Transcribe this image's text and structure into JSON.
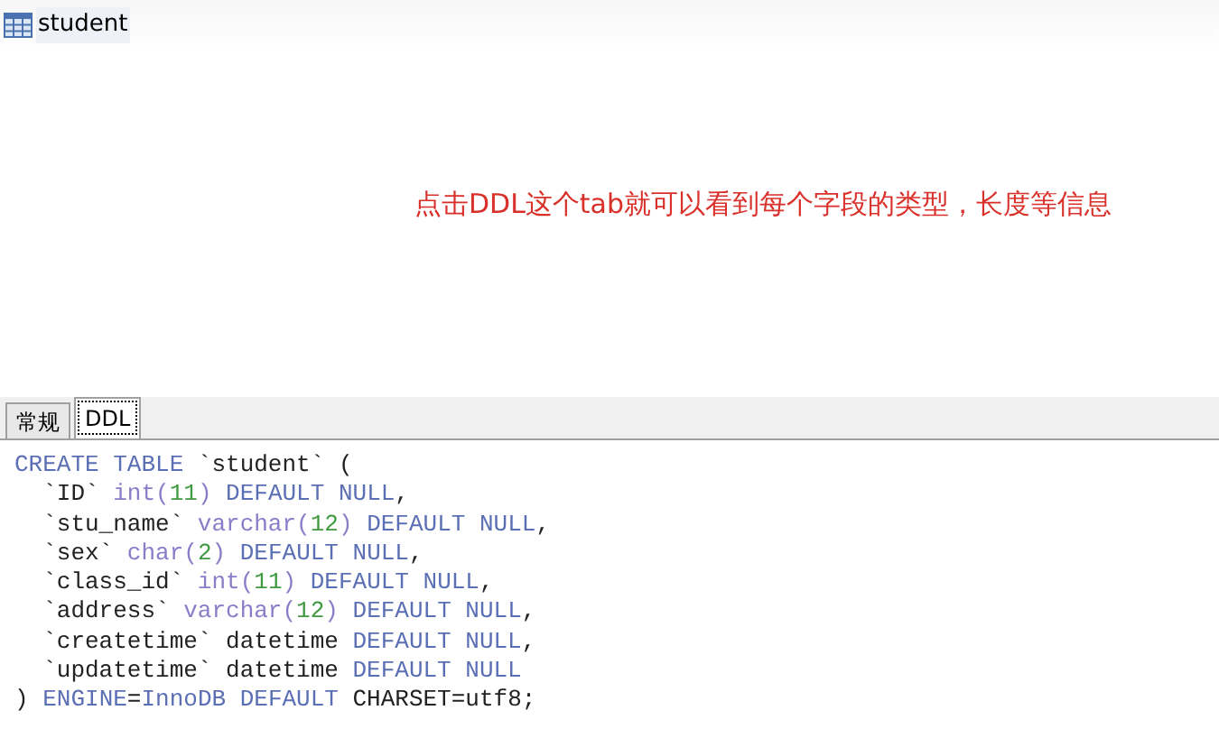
{
  "object": {
    "title": "student"
  },
  "note": "点击DDL这个tab就可以看到每个字段的类型，长度等信息",
  "tabs": [
    {
      "label": "常规",
      "selected": false
    },
    {
      "label": "DDL",
      "selected": true
    }
  ],
  "ddl": [
    [
      {
        "kind": "keyword",
        "text": "CREATE TABLE"
      },
      {
        "kind": "plain",
        "text": " `student` ("
      }
    ],
    [
      {
        "kind": "plain",
        "text": "  `ID` "
      },
      {
        "kind": "type",
        "text": "int("
      },
      {
        "kind": "number",
        "text": "11"
      },
      {
        "kind": "type",
        "text": ")"
      },
      {
        "kind": "keyword",
        "text": " DEFAULT NULL"
      },
      {
        "kind": "plain",
        "text": ","
      }
    ],
    [
      {
        "kind": "plain",
        "text": "  `stu_name` "
      },
      {
        "kind": "type",
        "text": "varchar("
      },
      {
        "kind": "number",
        "text": "12"
      },
      {
        "kind": "type",
        "text": ")"
      },
      {
        "kind": "keyword",
        "text": " DEFAULT NULL"
      },
      {
        "kind": "plain",
        "text": ","
      }
    ],
    [
      {
        "kind": "plain",
        "text": "  `sex` "
      },
      {
        "kind": "type",
        "text": "char("
      },
      {
        "kind": "number",
        "text": "2"
      },
      {
        "kind": "type",
        "text": ")"
      },
      {
        "kind": "keyword",
        "text": " DEFAULT NULL"
      },
      {
        "kind": "plain",
        "text": ","
      }
    ],
    [
      {
        "kind": "plain",
        "text": "  `class_id` "
      },
      {
        "kind": "type",
        "text": "int("
      },
      {
        "kind": "number",
        "text": "11"
      },
      {
        "kind": "type",
        "text": ")"
      },
      {
        "kind": "keyword",
        "text": " DEFAULT NULL"
      },
      {
        "kind": "plain",
        "text": ","
      }
    ],
    [
      {
        "kind": "plain",
        "text": "  `address` "
      },
      {
        "kind": "type",
        "text": "varchar("
      },
      {
        "kind": "number",
        "text": "12"
      },
      {
        "kind": "type",
        "text": ")"
      },
      {
        "kind": "keyword",
        "text": " DEFAULT NULL"
      },
      {
        "kind": "plain",
        "text": ","
      }
    ],
    [
      {
        "kind": "plain",
        "text": "  `createtime` datetime"
      },
      {
        "kind": "keyword",
        "text": " DEFAULT NULL"
      },
      {
        "kind": "plain",
        "text": ","
      }
    ],
    [
      {
        "kind": "plain",
        "text": "  `updatetime` datetime"
      },
      {
        "kind": "keyword",
        "text": " DEFAULT NULL"
      }
    ],
    [
      {
        "kind": "plain",
        "text": ") "
      },
      {
        "kind": "keyword",
        "text": "ENGINE"
      },
      {
        "kind": "plain",
        "text": "="
      },
      {
        "kind": "keyword",
        "text": "InnoDB DEFAULT"
      },
      {
        "kind": "plain",
        "text": " CHARSET=utf8;"
      }
    ]
  ]
}
